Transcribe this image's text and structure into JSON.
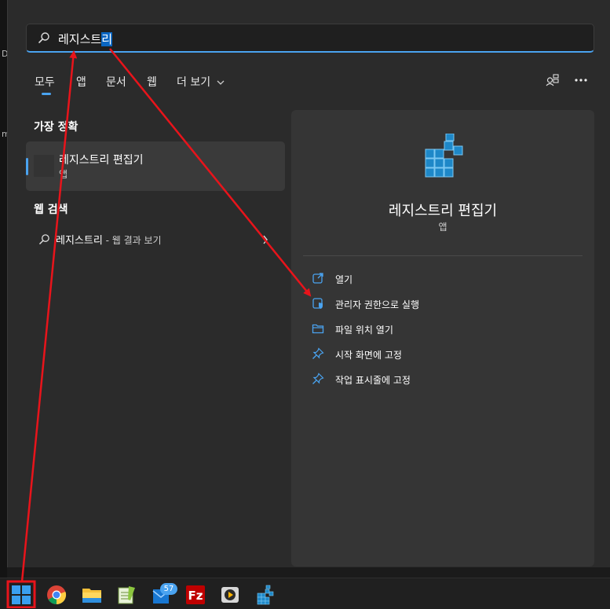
{
  "desktop": {
    "chars": [
      "D",
      "m"
    ]
  },
  "search": {
    "prefix": "레지스트",
    "selected": "리"
  },
  "tabs": [
    "모두",
    "앱",
    "문서",
    "웹",
    "더 보기"
  ],
  "best_match": {
    "heading": "가장 정확",
    "title": "레지스트리 편집기",
    "subtitle": "앱"
  },
  "web_search": {
    "heading": "웹 검색",
    "query": "레지스트리",
    "suffix": " - 웹 결과 보기"
  },
  "detail": {
    "name": "레지스트리 편집기",
    "type": "앱"
  },
  "actions": [
    {
      "icon": "open-icon",
      "label": "열기"
    },
    {
      "icon": "shield-admin-icon",
      "label": "관리자 권한으로 실행"
    },
    {
      "icon": "folder-icon",
      "label": "파일 위치 열기"
    },
    {
      "icon": "pin-icon",
      "label": "시작 화면에 고정"
    },
    {
      "icon": "pin-icon",
      "label": "작업 표시줄에 고정"
    }
  ],
  "taskbar": {
    "mail_badge": "57"
  },
  "colors": {
    "accent": "#4aa3f0",
    "annotation": "#e8141b"
  }
}
